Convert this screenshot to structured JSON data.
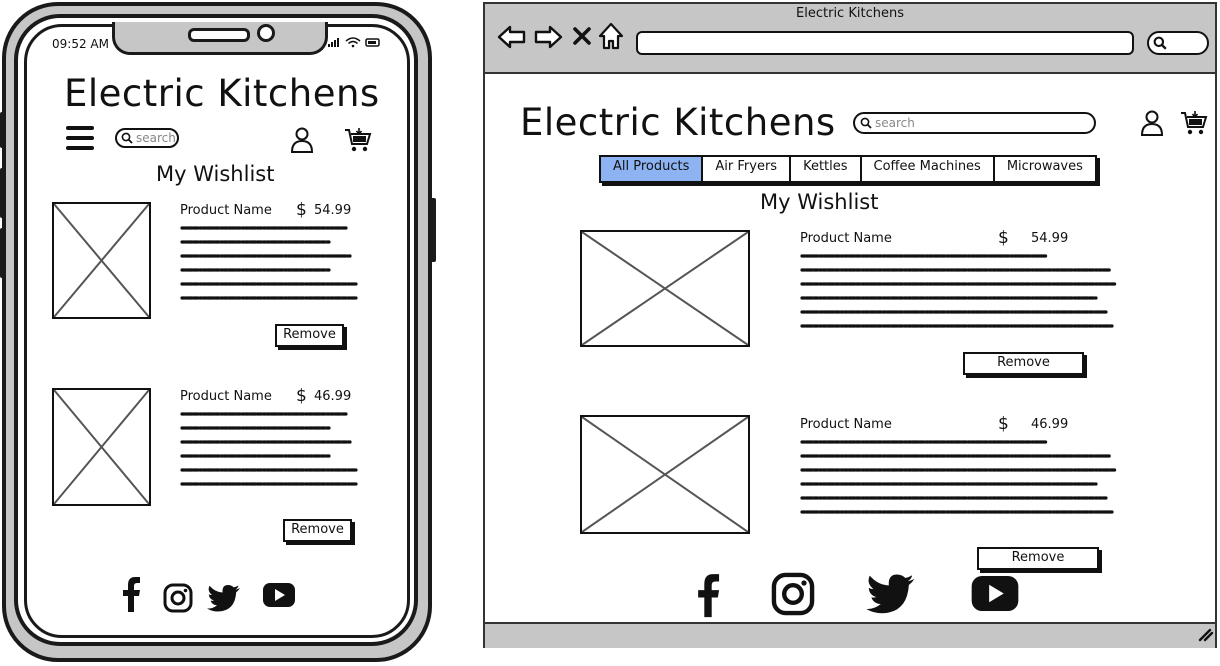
{
  "phone": {
    "time": "09:52 AM",
    "status": "signal wifi battery",
    "title": "Electric Kitchens",
    "search_placeholder": "search",
    "wishlist_title": "My Wishlist",
    "items": [
      {
        "name": "Product Name",
        "currency": "$",
        "price": "54.99",
        "remove_label": "Remove"
      },
      {
        "name": "Product Name",
        "currency": "$",
        "price": "46.99",
        "remove_label": "Remove"
      }
    ],
    "social": [
      "facebook-icon",
      "instagram-icon",
      "twitter-icon",
      "youtube-icon"
    ]
  },
  "browser": {
    "window_title": "Electric Kitchens",
    "nav_icons": [
      "back-icon",
      "forward-icon",
      "close-icon",
      "home-icon"
    ],
    "title": "Electric Kitchens",
    "search_placeholder": "search",
    "tabs": [
      {
        "label": "All Products",
        "active": true
      },
      {
        "label": "Air Fryers",
        "active": false
      },
      {
        "label": "Kettles",
        "active": false
      },
      {
        "label": "Coffee Machines",
        "active": false
      },
      {
        "label": "Microwaves",
        "active": false
      }
    ],
    "wishlist_title": "My Wishlist",
    "items": [
      {
        "name": "Product Name",
        "currency": "$",
        "price": "54.99",
        "remove_label": "Remove"
      },
      {
        "name": "Product Name",
        "currency": "$",
        "price": "46.99",
        "remove_label": "Remove"
      }
    ],
    "social": [
      "facebook-icon",
      "instagram-icon",
      "twitter-icon",
      "youtube-icon"
    ]
  },
  "colors": {
    "active_tab": "#8db3f2",
    "chrome": "#c6c6c6",
    "ink": "#111111"
  }
}
